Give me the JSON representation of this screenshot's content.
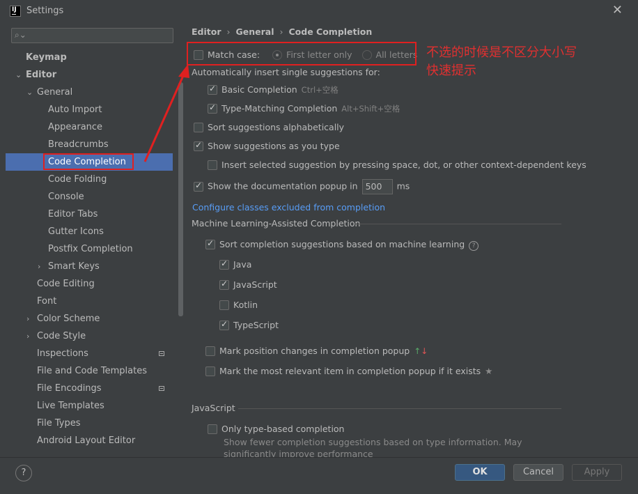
{
  "window": {
    "title": "Settings"
  },
  "sidebar": {
    "search_placeholder": "",
    "items": [
      {
        "label": "Keymap"
      },
      {
        "label": "Editor"
      },
      {
        "label": "General"
      },
      {
        "label": "Auto Import"
      },
      {
        "label": "Appearance"
      },
      {
        "label": "Breadcrumbs"
      },
      {
        "label": "Code Completion"
      },
      {
        "label": "Code Folding"
      },
      {
        "label": "Console"
      },
      {
        "label": "Editor Tabs"
      },
      {
        "label": "Gutter Icons"
      },
      {
        "label": "Postfix Completion"
      },
      {
        "label": "Smart Keys"
      },
      {
        "label": "Code Editing"
      },
      {
        "label": "Font"
      },
      {
        "label": "Color Scheme"
      },
      {
        "label": "Code Style"
      },
      {
        "label": "Inspections"
      },
      {
        "label": "File and Code Templates"
      },
      {
        "label": "File Encodings"
      },
      {
        "label": "Live Templates"
      },
      {
        "label": "File Types"
      },
      {
        "label": "Android Layout Editor"
      }
    ]
  },
  "breadcrumb": [
    "Editor",
    "General",
    "Code Completion"
  ],
  "match_case": {
    "label": "Match case:",
    "checked": false,
    "opt1": "First letter only",
    "opt2": "All letters"
  },
  "auto_insert_label": "Automatically insert single suggestions for:",
  "basic": {
    "label": "Basic Completion",
    "shortcut": "Ctrl+空格",
    "checked": true
  },
  "type_matching": {
    "label": "Type-Matching Completion",
    "shortcut": "Alt+Shift+空格",
    "checked": true
  },
  "sort_alpha": {
    "label": "Sort suggestions alphabetically",
    "checked": false
  },
  "show_as_type": {
    "label": "Show suggestions as you type",
    "checked": true
  },
  "insert_selected": {
    "label": "Insert selected suggestion by pressing space, dot, or other context-dependent keys",
    "checked": false
  },
  "doc_popup": {
    "label": "Show the documentation popup in",
    "value": "500",
    "unit": "ms",
    "checked": true
  },
  "configure_link": "Configure classes excluded from completion",
  "ml_section": "Machine Learning-Assisted Completion",
  "ml_sort": {
    "label": "Sort completion suggestions based on machine learning",
    "checked": true
  },
  "langs": [
    {
      "label": "Java",
      "checked": true
    },
    {
      "label": "JavaScript",
      "checked": true
    },
    {
      "label": "Kotlin",
      "checked": false
    },
    {
      "label": "TypeScript",
      "checked": true
    }
  ],
  "mark_position": {
    "label": "Mark position changes in completion popup",
    "checked": false
  },
  "mark_relevant": {
    "label": "Mark the most relevant item in completion popup if it exists",
    "checked": false
  },
  "js_section": "JavaScript",
  "only_type": {
    "label": "Only type-based completion",
    "checked": false,
    "desc1": "Show fewer completion suggestions based on type information. May",
    "desc2": "significantly improve performance"
  },
  "annotation": {
    "line1": "不选的时候是不区分大小写",
    "line2": "快速提示",
    "color": "#e02020"
  },
  "buttons": {
    "ok": "OK",
    "cancel": "Cancel",
    "apply": "Apply"
  },
  "colors": {
    "selection": "#4b6eaf",
    "link": "#589df6",
    "ok_button": "#365880"
  }
}
